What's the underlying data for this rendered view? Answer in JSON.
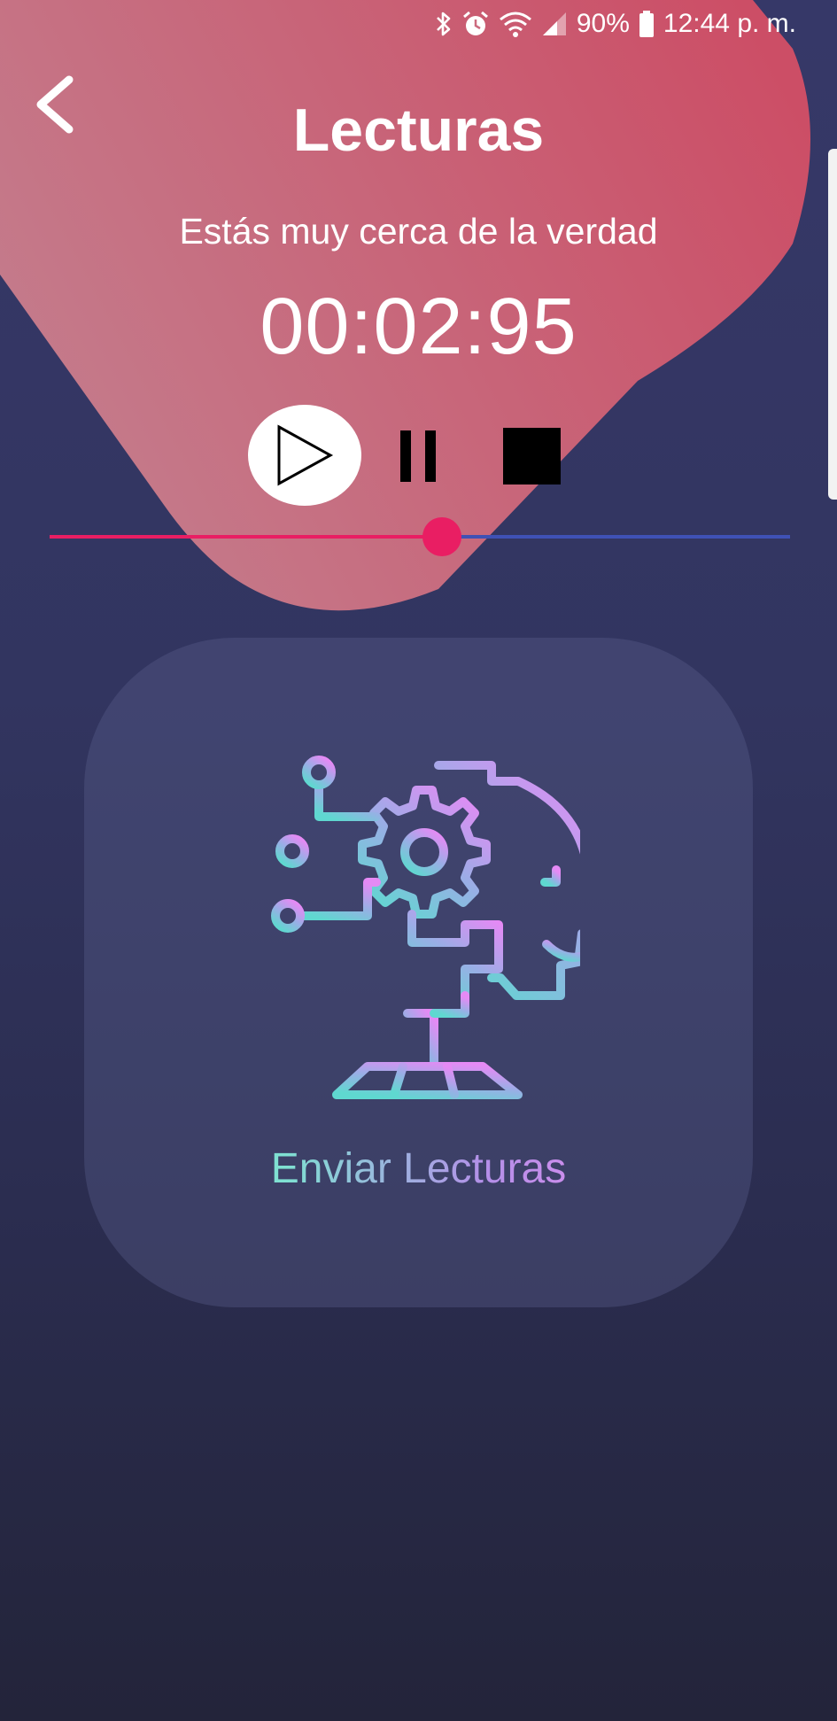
{
  "status_bar": {
    "battery_text": "90%",
    "time": "12:44 p. m.",
    "icons": [
      "bluetooth-icon",
      "alarm-icon",
      "wifi-icon",
      "signal-icon",
      "battery-icon"
    ]
  },
  "header": {
    "title": "Lecturas",
    "back_icon": "chevron-left-icon"
  },
  "player": {
    "subtitle": "Estás muy cerca de la verdad",
    "timer": "00:02:95",
    "progress": 0.53,
    "controls": [
      "play-icon",
      "pause-icon",
      "stop-icon"
    ]
  },
  "send_card": {
    "label": "Enviar Lecturas",
    "icon": "ai-head-gear-icon"
  },
  "colors": {
    "background_top": "#363868",
    "background_bottom": "#23243a",
    "blob_left": "#c47c8c",
    "blob_right": "#cc4e66",
    "slider_active": "#e91e63",
    "slider_inactive": "#3f51b5",
    "icon_gradient_start": "#5fd8d0",
    "icon_gradient_end": "#e58af5"
  }
}
